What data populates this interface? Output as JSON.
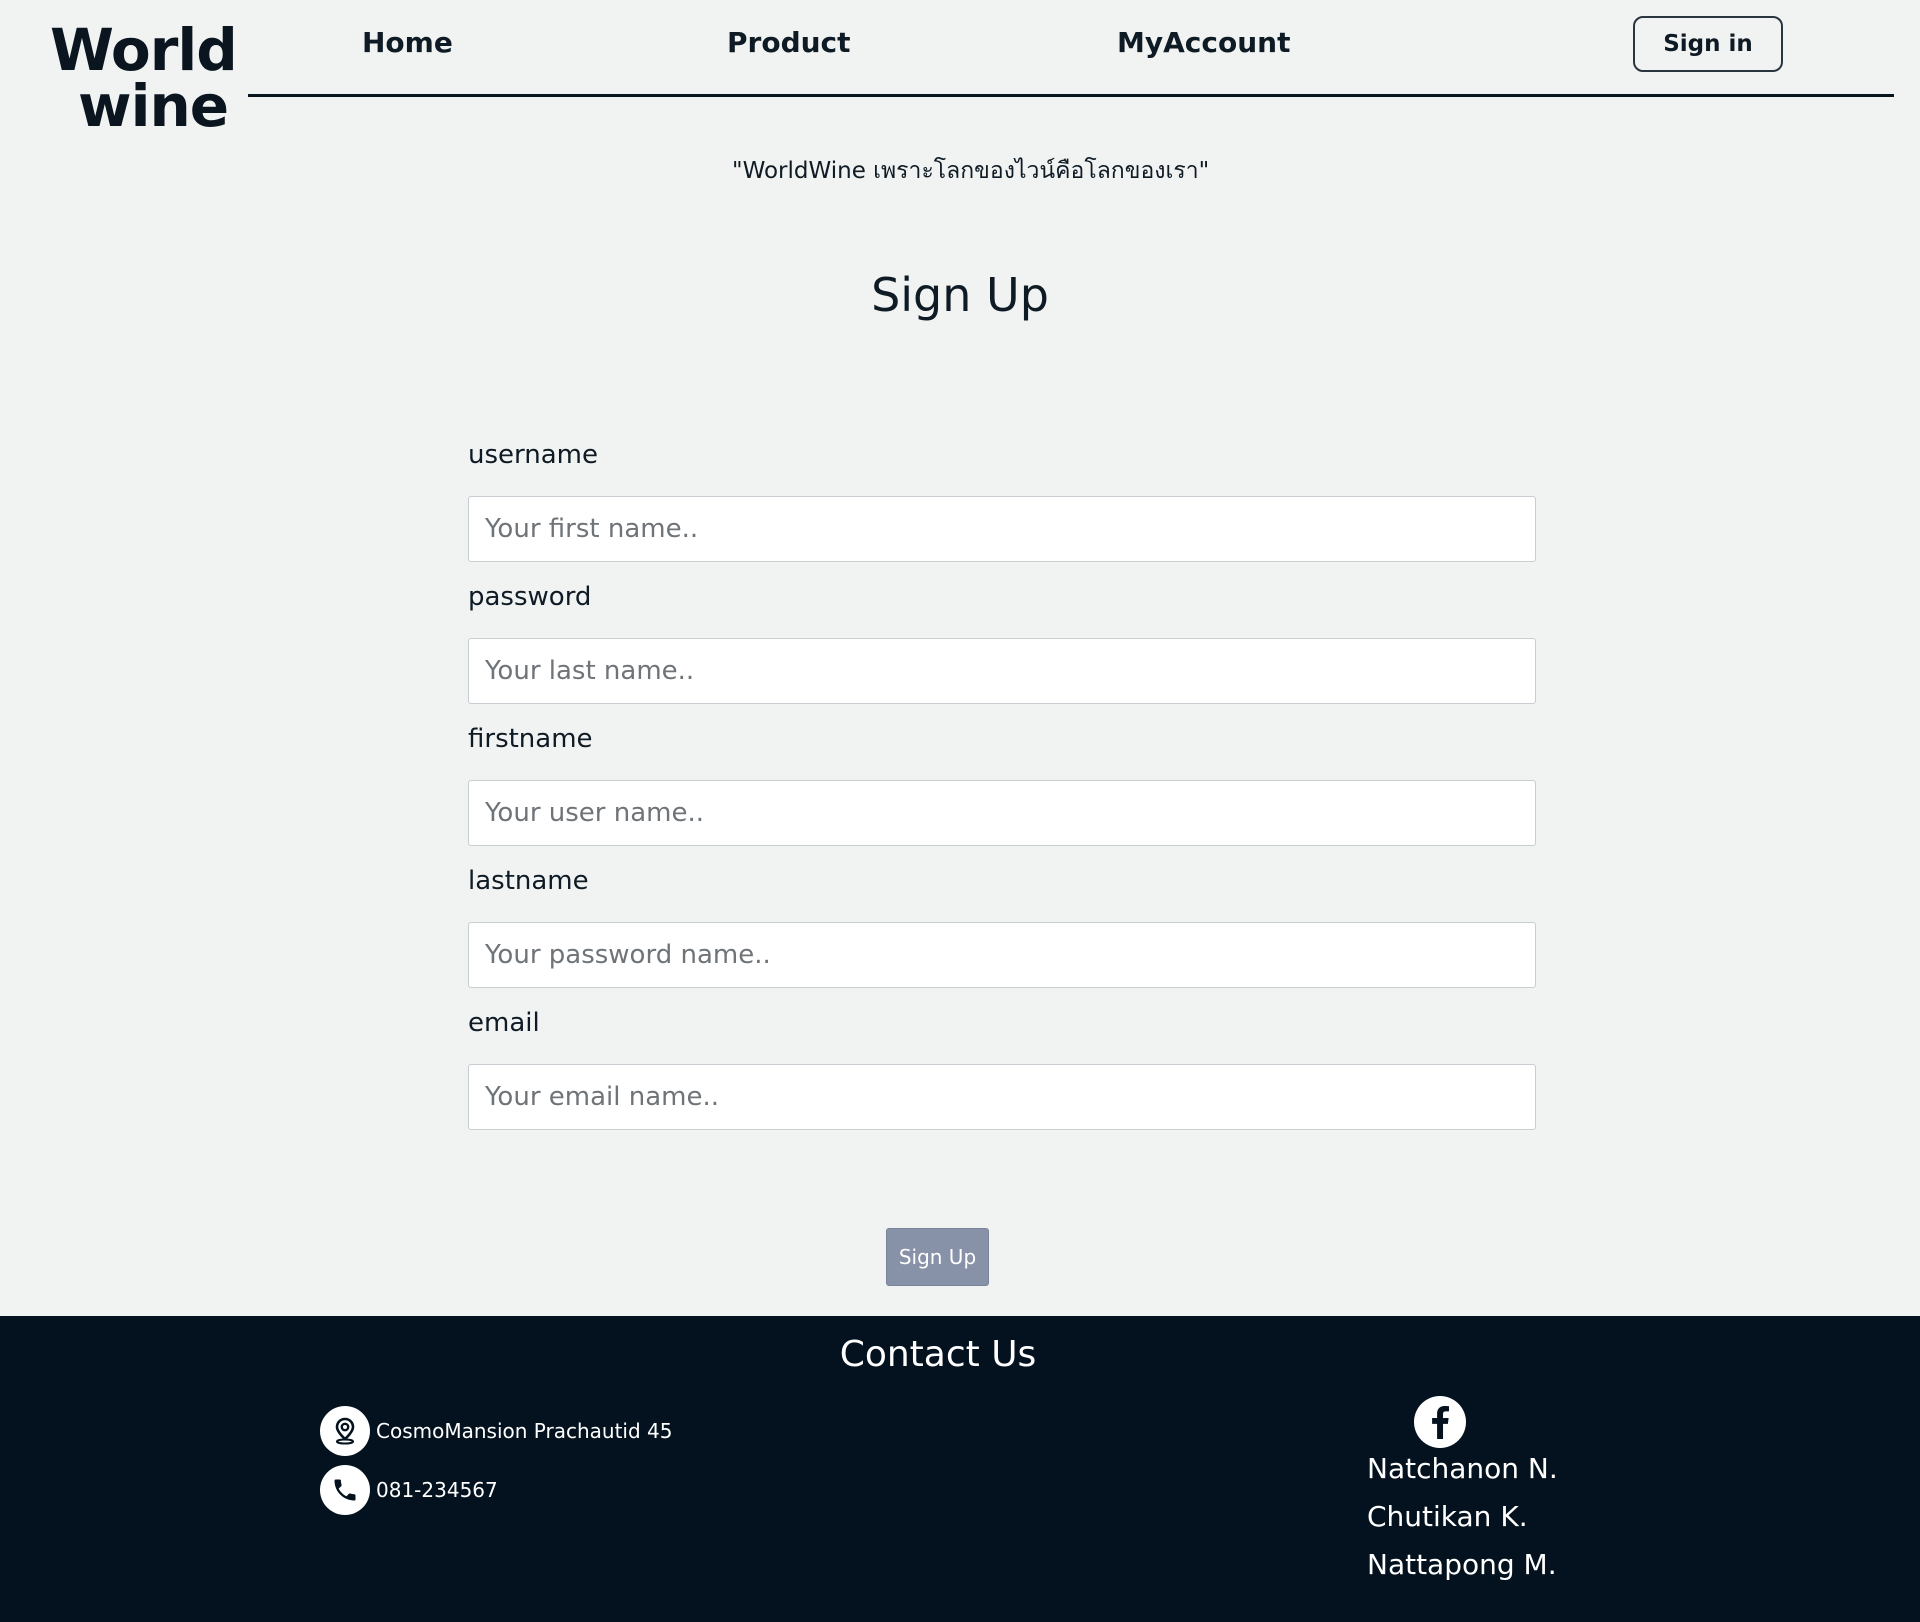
{
  "brand": {
    "line1": "World",
    "line2": "wine"
  },
  "nav": {
    "home": "Home",
    "product": "Product",
    "account": "MyAccount",
    "sign_in": "Sign in"
  },
  "tagline": "\"WorldWine เพราะโลกของไวน์คือโลกของเรา\"",
  "page_title": "Sign Up",
  "form": {
    "fields": [
      {
        "label": "username",
        "placeholder": "Your first name.."
      },
      {
        "label": "password",
        "placeholder": "Your last name.."
      },
      {
        "label": "firstname",
        "placeholder": "Your user name.."
      },
      {
        "label": "lastname",
        "placeholder": "Your password name.."
      },
      {
        "label": "email",
        "placeholder": "Your email name.."
      }
    ],
    "submit_label": "Sign Up"
  },
  "footer": {
    "title": "Contact Us",
    "address": "CosmoMansion Prachautid 45",
    "phone": "081-234567",
    "members": [
      "Natchanon N.",
      "Chutikan K.",
      "Nattapong M."
    ]
  },
  "icons": {
    "address": "map-pin-icon",
    "phone": "phone-icon",
    "social": "facebook-icon"
  },
  "colors": {
    "background": "#f1f3f2",
    "footer_bg": "#03121e",
    "submit_button": "#8791a8",
    "text": "#0e1a24"
  }
}
